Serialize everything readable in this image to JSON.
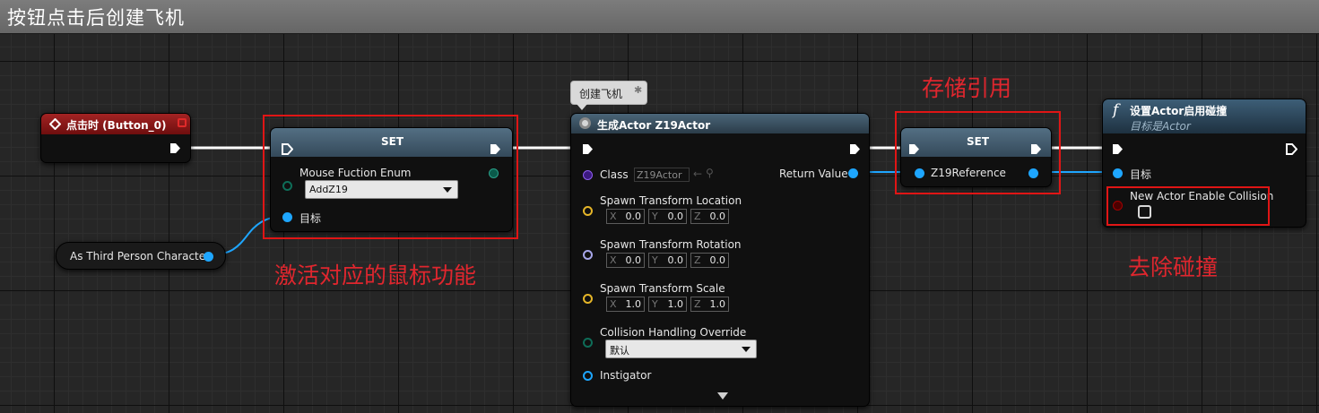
{
  "graph_title": "按钮点击后创建飞机",
  "colors": {
    "event_header": "#8b1414",
    "set_header": "#4f6b80",
    "func_header": "#36546b",
    "annotation": "#e0262e",
    "exec_wire": "#ffffff",
    "object_wire": "#1ea6ff"
  },
  "event_node": {
    "title": "点击时 (Button_0)",
    "icon": "event-diamond-icon"
  },
  "var_node": {
    "label": "As Third Person Character"
  },
  "set_node_1": {
    "title": "SET",
    "pin_label": "Mouse Fuction Enum",
    "enum_value": "AddZ19",
    "target_label": "目标"
  },
  "comment_bubble": {
    "text": "创建飞机"
  },
  "spawn_node": {
    "title": "生成Actor Z19Actor",
    "class_label": "Class",
    "class_value": "Z19Actor",
    "return_label": "Return Value",
    "location_label": "Spawn Transform Location",
    "location": {
      "x": "0.0",
      "y": "0.0",
      "z": "0.0"
    },
    "rotation_label": "Spawn Transform Rotation",
    "rotation": {
      "x": "0.0",
      "y": "0.0",
      "z": "0.0"
    },
    "scale_label": "Spawn Transform Scale",
    "scale": {
      "x": "1.0",
      "y": "1.0",
      "z": "1.0"
    },
    "collision_label": "Collision Handling Override",
    "collision_value": "默认",
    "instigator_label": "Instigator",
    "axis_x": "X",
    "axis_y": "Y",
    "axis_z": "Z"
  },
  "set_node_2": {
    "title": "SET",
    "pin_label": "Z19Reference"
  },
  "func_node": {
    "title": "设置Actor启用碰撞",
    "subtitle": "目标是Actor",
    "target_label": "目标",
    "param_label": "New Actor Enable Collision",
    "param_checked": false
  },
  "annotations": {
    "activate": "激活对应的鼠标功能",
    "store": "存储引用",
    "remove": "去除碰撞"
  }
}
